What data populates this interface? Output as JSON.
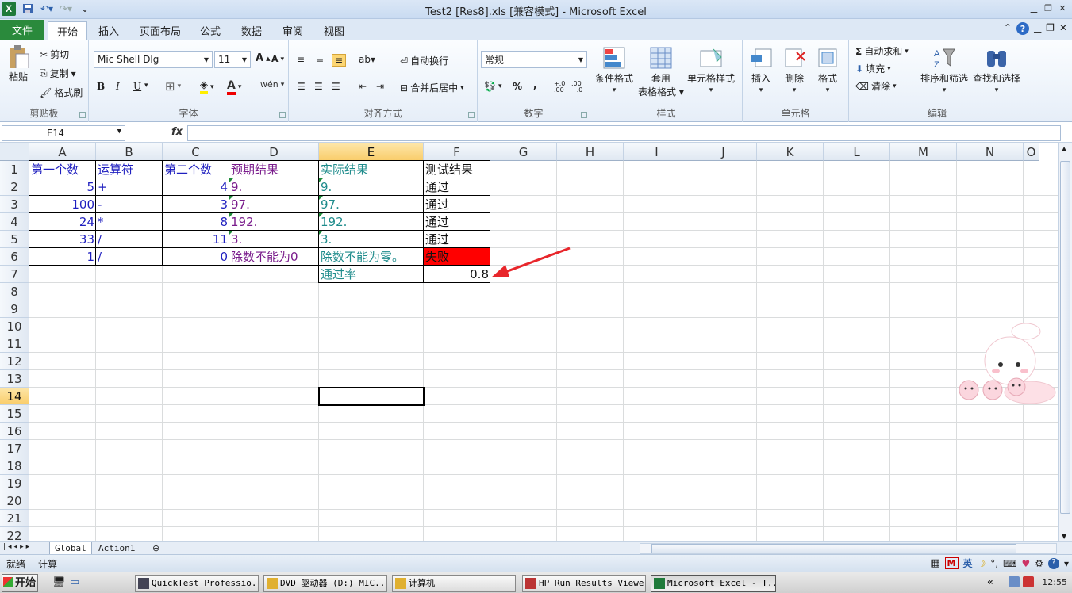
{
  "window": {
    "title": "Test2 [Res8].xls  [兼容模式]  -  Microsoft Excel"
  },
  "tabs": [
    "文件",
    "开始",
    "插入",
    "页面布局",
    "公式",
    "数据",
    "审阅",
    "视图"
  ],
  "ribbon": {
    "clipboard": {
      "paste": "粘贴",
      "cut": "剪切",
      "copy": "复制",
      "format_painter": "格式刷",
      "label": "剪贴板"
    },
    "font": {
      "name": "Mic Shell Dlg",
      "size": "11",
      "bold": "B",
      "italic": "I",
      "underline": "U",
      "phonetic": "wén",
      "label": "字体"
    },
    "alignment": {
      "wrap": "自动换行",
      "merge": "合并后居中",
      "label": "对齐方式"
    },
    "number": {
      "format": "常规",
      "percent": "%",
      "comma": ",",
      "inc": "+.0 .00",
      "dec": ".00 +.0",
      "label": "数字"
    },
    "styles": {
      "conditional": "条件格式",
      "table_line1": "套用",
      "table_line2": "表格格式",
      "cell_styles": "单元格样式",
      "label": "样式"
    },
    "cells": {
      "insert": "插入",
      "delete": "删除",
      "format": "格式",
      "label": "单元格"
    },
    "editing": {
      "autosum": "自动求和",
      "fill": "填充",
      "clear": "清除",
      "sort": "排序和筛选",
      "find": "查找和选择",
      "label": "编辑"
    }
  },
  "formula_bar": {
    "name_box": "E14",
    "fx": "fx",
    "value": ""
  },
  "columns": [
    "A",
    "B",
    "C",
    "D",
    "E",
    "F",
    "G",
    "H",
    "I",
    "J",
    "K",
    "L",
    "M",
    "N",
    "O"
  ],
  "rows": [
    "1",
    "2",
    "3",
    "4",
    "5",
    "6",
    "7",
    "8",
    "9",
    "10",
    "11",
    "12",
    "13",
    "14",
    "15",
    "16",
    "17",
    "18",
    "19",
    "20",
    "21",
    "22"
  ],
  "table": {
    "headers": [
      "第一个数",
      "运算符",
      "第二个数",
      "预期结果",
      "实际结果",
      "测试结果"
    ],
    "data": [
      [
        "5",
        "+",
        "4",
        "9.",
        "9.",
        "通过"
      ],
      [
        "100",
        "-",
        "3",
        "97.",
        "97.",
        "通过"
      ],
      [
        "24",
        "*",
        "8",
        "192.",
        "192.",
        "通过"
      ],
      [
        "33",
        "/",
        "11",
        "3.",
        "3.",
        "通过"
      ],
      [
        "1",
        "/",
        "0",
        "除数不能为0",
        "除数不能为零。",
        "失败"
      ]
    ],
    "pass_rate_label": "通过率",
    "pass_rate_value": "0.8"
  },
  "colors": {
    "fail_fill": "#ff0000",
    "arrow": "#e8262b",
    "selected_header": "#f9cd6b",
    "file_tab": "#2a8a3c"
  },
  "sheets": [
    "Global",
    "Action1"
  ],
  "status": {
    "ready": "就绪",
    "calc": "计算"
  },
  "taskbar": {
    "start": "开始",
    "items": [
      "QuickTest Professio...",
      "DVD 驱动器 (D:) MIC...",
      "计算机",
      "HP Run Results Viewer",
      "Microsoft Excel - T..."
    ],
    "clock": "12:55"
  },
  "ime": {
    "mode": "英"
  }
}
